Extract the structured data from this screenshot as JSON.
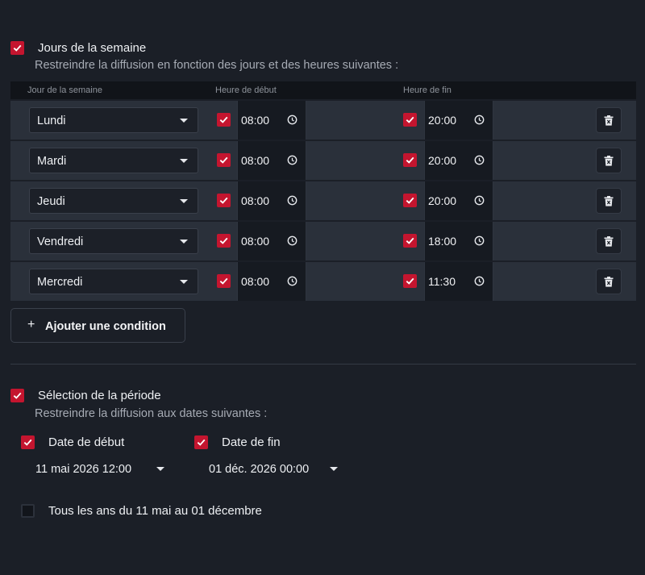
{
  "days_section": {
    "title": "Jours de la semaine",
    "subtitle": "Restreindre la diffusion en fonction des jours et des heures suivantes :",
    "columns": {
      "day": "Jour de la semaine",
      "start": "Heure de début",
      "end": "Heure de fin"
    },
    "rows": [
      {
        "day": "Lundi",
        "start": "08:00",
        "end": "20:00"
      },
      {
        "day": "Mardi",
        "start": "08:00",
        "end": "20:00"
      },
      {
        "day": "Jeudi",
        "start": "08:00",
        "end": "20:00"
      },
      {
        "day": "Vendredi",
        "start": "08:00",
        "end": "18:00"
      },
      {
        "day": "Mercredi",
        "start": "08:00",
        "end": "11:30"
      }
    ],
    "add_condition_label": "Ajouter une condition"
  },
  "period_section": {
    "title": "Sélection de la période",
    "subtitle": "Restreindre la diffusion aux dates suivantes :",
    "start_label": "Date de début",
    "start_value": "11 mai 2026 12:00",
    "end_label": "Date de fin",
    "end_value": "01 déc. 2026 00:00",
    "yearly_label": "Tous les ans du 11 mai au 01 décembre"
  },
  "colors": {
    "background": "#1b1f27",
    "accent": "#c4152f",
    "row": "#2a303a"
  }
}
